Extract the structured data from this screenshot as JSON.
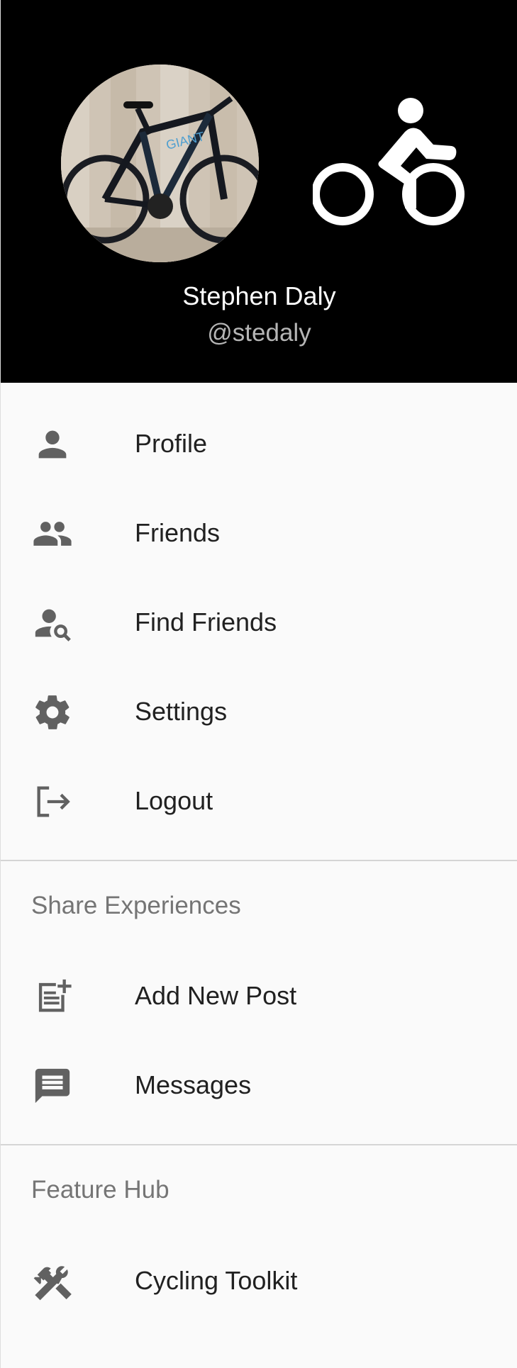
{
  "header": {
    "user_name": "Stephen Daly",
    "user_handle": "@stedaly",
    "avatar_icon": "bicycle-photo",
    "logo_icon": "cyclist-icon"
  },
  "menu": {
    "profile": {
      "label": "Profile",
      "icon": "person-icon"
    },
    "friends": {
      "label": "Friends",
      "icon": "people-icon"
    },
    "find_friends": {
      "label": "Find Friends",
      "icon": "person-search-icon"
    },
    "settings": {
      "label": "Settings",
      "icon": "gear-icon"
    },
    "logout": {
      "label": "Logout",
      "icon": "logout-icon"
    }
  },
  "share_section": {
    "title": "Share Experiences",
    "add_post": {
      "label": "Add New Post",
      "icon": "post-add-icon"
    },
    "messages": {
      "label": "Messages",
      "icon": "message-icon"
    }
  },
  "feature_section": {
    "title": "Feature Hub",
    "cycling_toolkit": {
      "label": "Cycling Toolkit",
      "icon": "tools-icon"
    }
  },
  "colors": {
    "header_bg": "#000000",
    "drawer_bg": "#fafafa",
    "text": "#212121",
    "icon": "#616161",
    "section_title": "#757575",
    "divider": "#d5d5d5"
  }
}
